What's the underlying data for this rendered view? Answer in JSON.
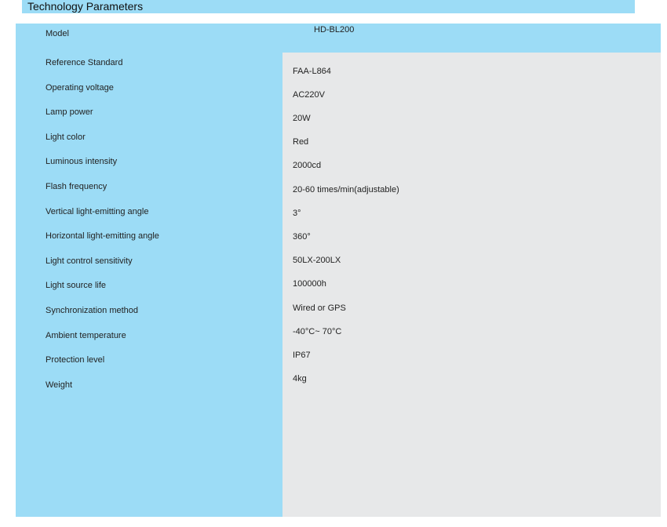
{
  "header": {
    "title": "Technology Parameters"
  },
  "model": {
    "label": "Model",
    "value": "HD-BL200"
  },
  "labels": [
    "Reference Standard",
    "Operating voltage",
    "Lamp power",
    "Light color",
    "Luminous intensity",
    "Flash frequency",
    "Vertical light-emitting angle",
    "Horizontal light-emitting angle",
    "Light control sensitivity",
    "Light source life",
    "Synchronization method",
    "Ambient temperature",
    "Protection level",
    "Weight"
  ],
  "values": [
    "FAA-L864",
    "AC220V",
    "20W",
    "Red",
    "2000cd",
    "20-60 times/min(adjustable)",
    "3°",
    "360°",
    "50LX-200LX",
    "100000h",
    "Wired or GPS",
    "-40°C~ 70°C",
    "IP67",
    "4kg"
  ],
  "colors": {
    "header_blue": "#9cdcf6",
    "label_column_blue": "#9cdcf6",
    "value_panel_gray": "#e7e8e9"
  }
}
